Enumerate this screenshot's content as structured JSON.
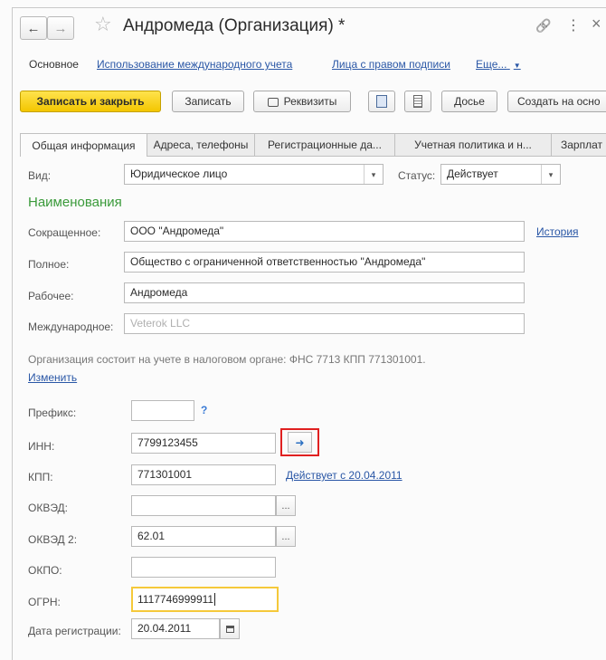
{
  "window": {
    "title": "Андромеда (Организация) *",
    "back_icon": "arrow-left-icon",
    "forward_icon": "arrow-right-icon",
    "favorite_icon": "star-icon",
    "link_icon": "link-icon",
    "more_icon": "more-vertical-icon",
    "close_icon": "close-icon",
    "back_glyph": "←",
    "forward_glyph": "→",
    "star_glyph": "☆",
    "link_glyph": "🔗",
    "more_glyph": "⋮",
    "close_glyph": "×"
  },
  "nav_links": {
    "main": "Основное",
    "intl": "Использование международного учета",
    "signers": "Лица с правом подписи",
    "more": "Еще...",
    "more_arrow": "▼"
  },
  "toolbar": {
    "save_close": "Записать и закрыть",
    "save": "Записать",
    "requisites": "Реквизиты",
    "dossier": "Досье",
    "create_based": "Создать на осно"
  },
  "tabs": [
    "Общая информация",
    "Адреса, телефоны",
    "Регистрационные да...",
    "Учетная политика и н...",
    "Зарплат"
  ],
  "form": {
    "vid_label": "Вид:",
    "vid_value": "Юридическое лицо",
    "status_label": "Статус:",
    "status_value": "Действует",
    "section_names": "Наименования",
    "short_label": "Сокращенное:",
    "short_value": "ООО \"Андромеда\"",
    "history_link": "История",
    "full_label": "Полное:",
    "full_value": "Общество с ограниченной ответственностью \"Андромеда\"",
    "work_label": "Рабочее:",
    "work_value": "Андромеда",
    "intl_label": "Международное:",
    "intl_placeholder": "Veterok LLC",
    "tax_info": "Организация состоит на учете в налоговом органе: ФНС 7713 КПП 771301001.",
    "change_link": "Изменить",
    "prefix_label": "Префикс:",
    "prefix_value": "",
    "prefix_help": "?",
    "inn_label": "ИНН:",
    "inn_value": "7799123455",
    "kpp_label": "КПП:",
    "kpp_value": "771301001",
    "kpp_link": "Действует с 20.04.2011",
    "okved_label": "ОКВЭД:",
    "okved_value": "",
    "okved2_label": "ОКВЭД 2:",
    "okved2_value": "62.01",
    "okpo_label": "ОКПО:",
    "okpo_value": "",
    "ogrn_label": "ОГРН:",
    "ogrn_value": "1117746999911",
    "reg_date_label": "Дата регистрации:",
    "reg_date_value": "20.04.2011",
    "select_glyph": "...",
    "dropdown_glyph": "▾"
  },
  "colors": {
    "accent_yellow": "#f5c93a",
    "link_blue": "#2a57a6",
    "section_green": "#3a9a3a",
    "highlight_red": "#e02020"
  }
}
